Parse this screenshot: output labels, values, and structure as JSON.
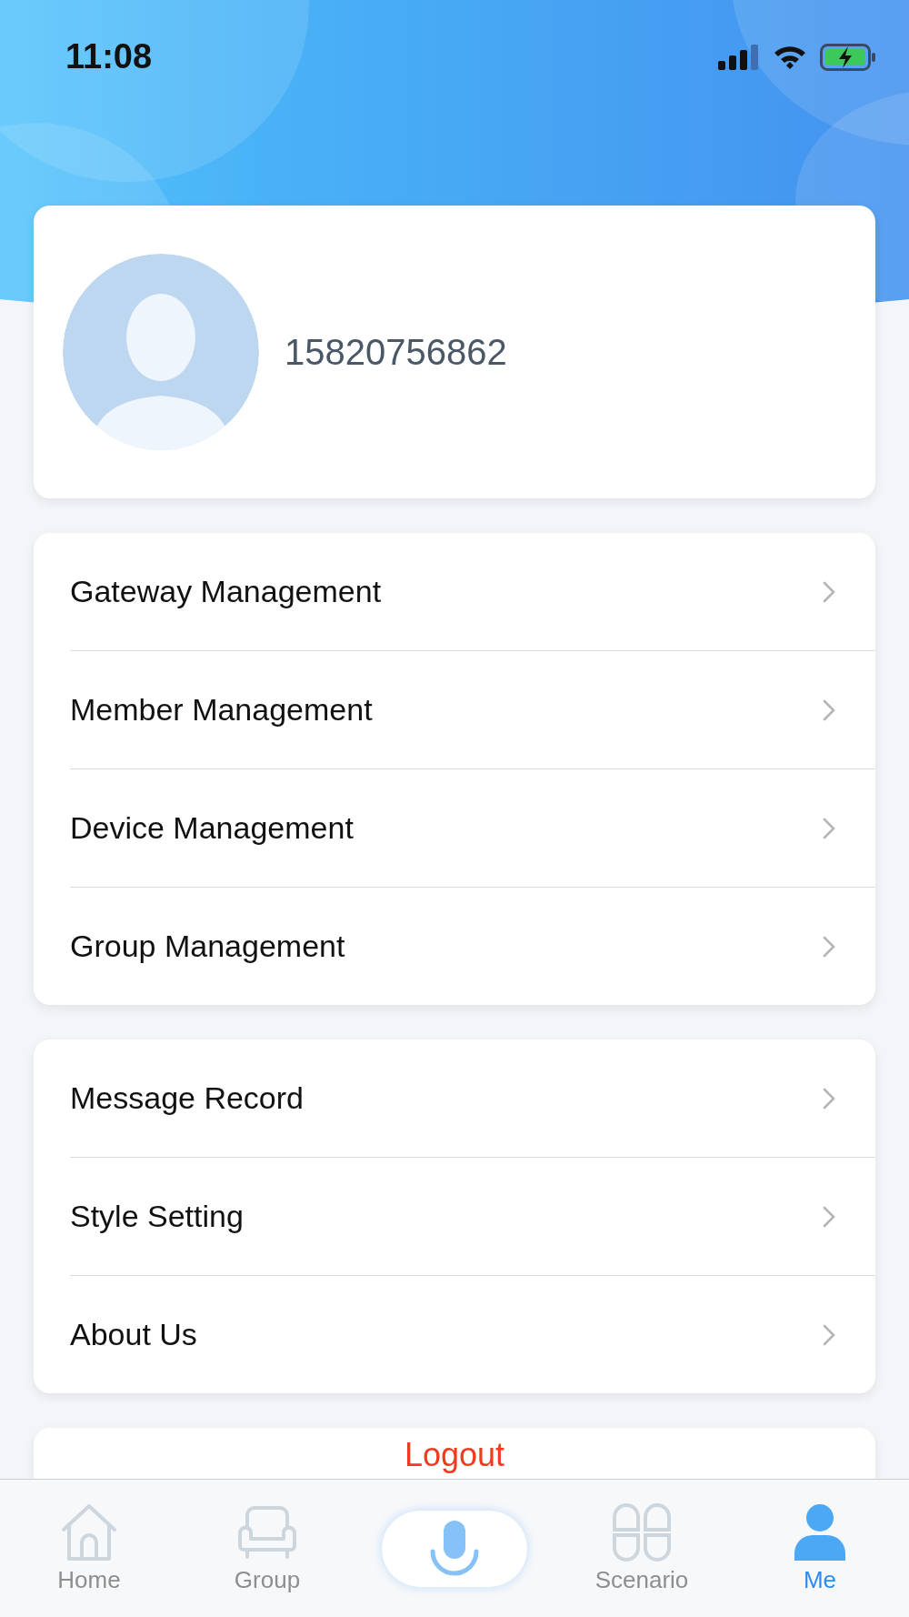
{
  "status_bar": {
    "time": "11:08"
  },
  "profile": {
    "phone": "15820756862"
  },
  "menu_groups": [
    {
      "items": [
        {
          "label": "Gateway Management"
        },
        {
          "label": "Member Management"
        },
        {
          "label": "Device Management"
        },
        {
          "label": "Group Management"
        }
      ]
    },
    {
      "items": [
        {
          "label": "Message Record"
        },
        {
          "label": "Style Setting"
        },
        {
          "label": "About Us"
        }
      ]
    }
  ],
  "logout": {
    "label": "Logout"
  },
  "tab_bar": [
    {
      "kind": "home",
      "label": "Home",
      "selected": false
    },
    {
      "kind": "group",
      "label": "Group",
      "selected": false
    },
    {
      "kind": "voice",
      "selected": false
    },
    {
      "kind": "scenario",
      "label": "Scenario",
      "selected": false
    },
    {
      "kind": "me",
      "label": "Me",
      "selected": true
    }
  ]
}
